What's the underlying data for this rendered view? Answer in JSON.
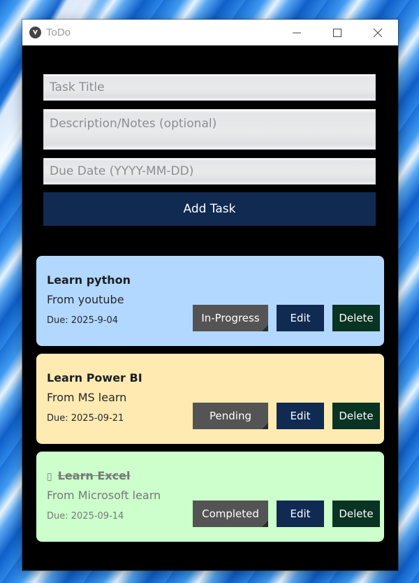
{
  "window": {
    "title": "ToDo"
  },
  "form": {
    "title_placeholder": "Task Title",
    "desc_placeholder": "Description/Notes (optional)",
    "due_placeholder": "Due Date (YYYY-MM-DD)",
    "add_label": "Add Task"
  },
  "tasks": [
    {
      "title": "Learn python",
      "description": "From youtube",
      "due": "Due: 2025-9-04",
      "status": "In-Progress",
      "edit": "Edit",
      "delete": "Delete",
      "color": "#b3d8ff"
    },
    {
      "title": "Learn Power BI",
      "description": "From MS learn",
      "due": "Due: 2025-09-21",
      "status": "Pending",
      "edit": "Edit",
      "delete": "Delete",
      "color": "#ffebb2"
    },
    {
      "title": "Learn Excel",
      "checkmark": "▯",
      "description": "From Microsoft learn",
      "due": "Due: 2025-09-14",
      "status": "Completed",
      "edit": "Edit",
      "delete": "Delete",
      "color": "#ccffcc"
    }
  ],
  "colors": {
    "primary": "#102a52",
    "delete": "#093322",
    "status": "#545454"
  }
}
